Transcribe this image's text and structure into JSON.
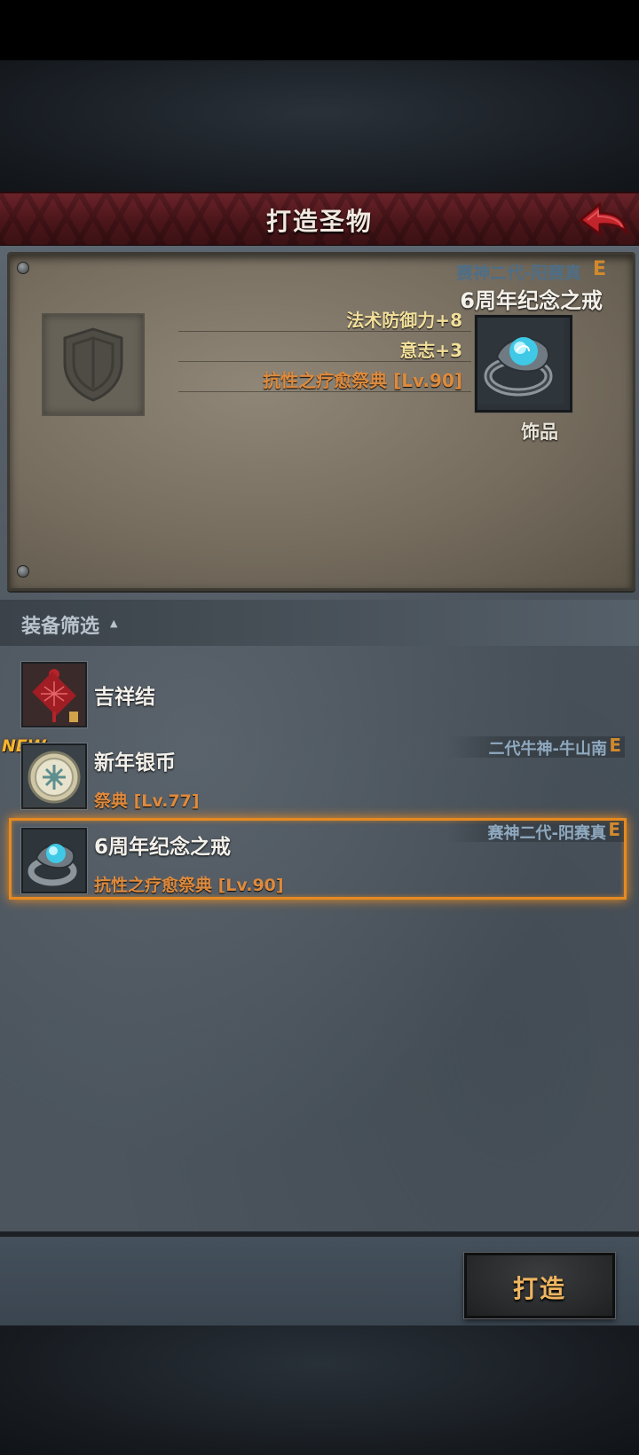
{
  "header": {
    "title": "打造圣物"
  },
  "preview": {
    "source": "赛神二代-阳赛真",
    "grade": "E",
    "item_name": "6周年纪念之戒",
    "stats": [
      "法术防御力+8",
      "意志+3"
    ],
    "effect": "抗性之疗愈祭典 [Lv.90]",
    "slot_label": "饰品"
  },
  "filter": {
    "label": "装备筛选",
    "caret": "▲"
  },
  "list": [
    {
      "name": "吉祥结",
      "sub": "",
      "source": "",
      "grade": "",
      "badge": ""
    },
    {
      "name": "新年银币",
      "sub": "祭典 [Lv.77]",
      "source": "二代牛神-牛山南",
      "grade": "E",
      "badge": "NEW"
    },
    {
      "name": "6周年纪念之戒",
      "sub": "抗性之疗愈祭典 [Lv.90]",
      "source": "赛神二代-阳赛真",
      "grade": "E",
      "badge": ""
    }
  ],
  "actions": {
    "forge_label": "打造"
  },
  "colors": {
    "title_bar": "#5a1c21",
    "stat_yellow": "#f2df9a",
    "effect_orange": "#df8a3c",
    "grade": "#d28a2c",
    "selection": "#e58a21"
  }
}
